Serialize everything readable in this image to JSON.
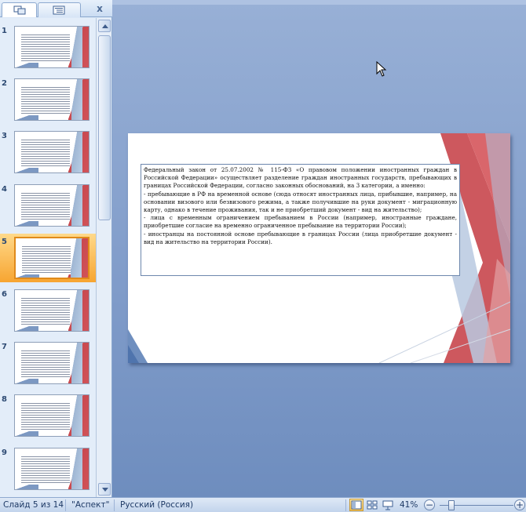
{
  "panel": {
    "tabs": [
      {
        "name": "slides",
        "icon": "slides-tab-icon"
      },
      {
        "name": "outline",
        "icon": "outline-tab-icon"
      }
    ],
    "close_label": "x"
  },
  "thumbnails": [
    {
      "num": "1"
    },
    {
      "num": "2"
    },
    {
      "num": "3"
    },
    {
      "num": "4"
    },
    {
      "num": "5"
    },
    {
      "num": "6"
    },
    {
      "num": "7"
    },
    {
      "num": "8"
    },
    {
      "num": "9"
    }
  ],
  "selected_slide": 5,
  "slide": {
    "paragraphs": [
      "Федеральный закон от 25.07.2002 № 115-ФЗ «О правовом положении иностранных граждан в Российской Федерации» осуществляет разделение граждан иностранных государств, пребывающих в границах Российской Федерации, согласно законных обоснований, на 3 категории, а именно:",
      "- пребывающие в РФ на временной основе (сюда относят иностранных лица, прибывшие, например, на основании визового или безвизового режима, а также получившие на руки документ - миграционную карту, однако в течение проживания, так и не приобретший документ - вид на жительство);",
      "- лица с временным ограничением пребыванием в России (например, иностранные граждане, приобретшие согласие на временно ограниченное пребывание на территории России);",
      "- иностранцы на постоянной основе пребывающие в границах России (лица приобретшие документ - вид на жительство на территории России)."
    ]
  },
  "status": {
    "slide_info": "Слайд 5 из 14",
    "theme": "\"Аспект\"",
    "language": "Русский (Россия)",
    "zoom": "41%",
    "zoom_minus": "−",
    "zoom_plus": "+"
  },
  "colors": {
    "accent_red": "#c9494f",
    "panel_bg": "#dbe8f7",
    "workspace": "#7f9bc9",
    "selection": "#f7a531"
  }
}
